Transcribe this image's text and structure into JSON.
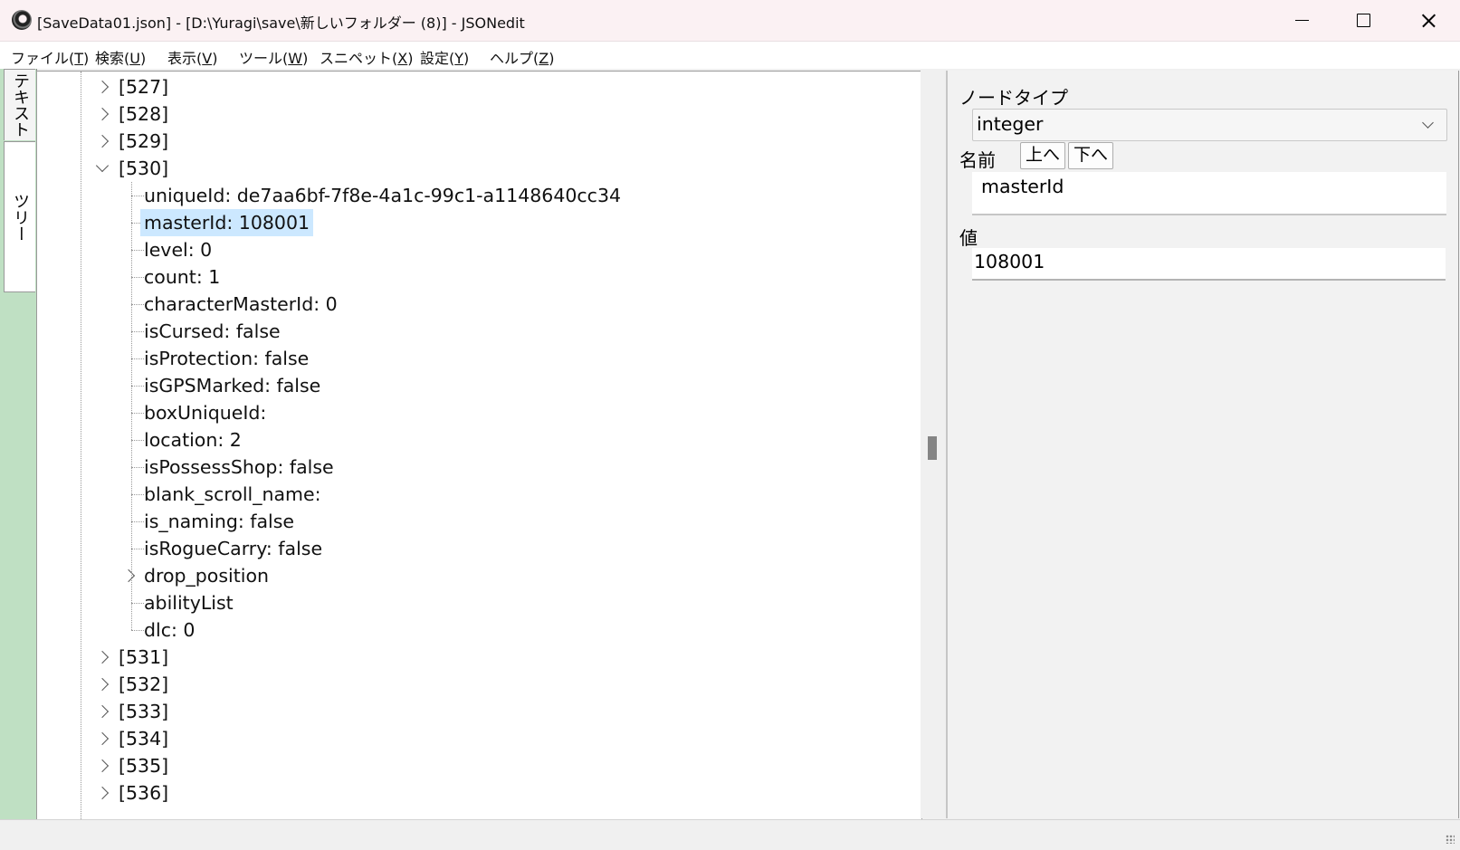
{
  "window": {
    "title": "[SaveData01.json] - [D:\\Yuragi\\save\\新しいフォルダー (8)] - JSONedit"
  },
  "menu": [
    {
      "label": "ファイル(",
      "key": "T",
      "tail": ")"
    },
    {
      "label": "検索(",
      "key": "U",
      "tail": ")"
    },
    {
      "label": "表示(",
      "key": "V",
      "tail": ")"
    },
    {
      "label": "ツール(",
      "key": "W",
      "tail": ")"
    },
    {
      "label": "スニペット(",
      "key": "X",
      "tail": ")"
    },
    {
      "label": "設定(",
      "key": "Y",
      "tail": ")"
    },
    {
      "label": "ヘルプ(",
      "key": "Z",
      "tail": ")"
    }
  ],
  "side_tabs": {
    "text": "テキスト",
    "tree": "ツリー"
  },
  "tree": {
    "items_before": [
      "[527]",
      "[528]",
      "[529]"
    ],
    "expanded": "[530]",
    "children": [
      "uniqueId: de7aa6bf-7f8e-4a1c-99c1-a1148640cc34",
      "masterId: 108001",
      "level: 0",
      "count: 1",
      "characterMasterId: 0",
      "isCursed: false",
      "isProtection: false",
      "isGPSMarked: false",
      "boxUniqueId:",
      "location: 2",
      "isPossessShop: false",
      "blank_scroll_name:",
      "is_naming: false",
      "isRogueCarry: false",
      "drop_position",
      "abilityList",
      "dlc: 0"
    ],
    "items_after": [
      "[531]",
      "[532]",
      "[533]",
      "[534]",
      "[535]",
      "[536]"
    ],
    "selected_index": 1
  },
  "props": {
    "node_type_label": "ノードタイプ",
    "node_type_value": "integer",
    "name_label": "名前",
    "up_button": "上へ",
    "down_button": "下へ",
    "name_value": "masterId",
    "value_label": "値",
    "value_value": "108001"
  }
}
